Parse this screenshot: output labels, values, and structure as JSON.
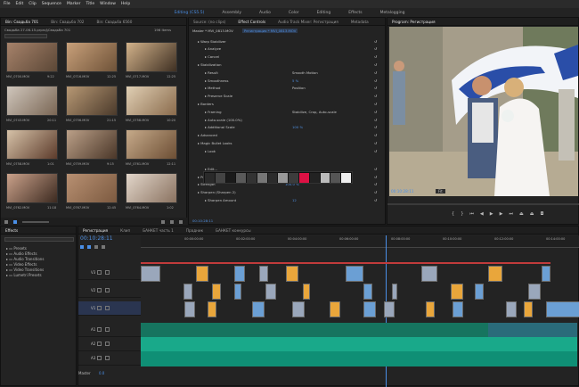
{
  "menu": [
    "File",
    "Edit",
    "Clip",
    "Sequence",
    "Marker",
    "Title",
    "Window",
    "Help"
  ],
  "workspaces": {
    "active": "Editing (CS5.5)",
    "items": [
      "Assembly",
      "Audio",
      "Color",
      "Editing",
      "Effects",
      "Metalogging"
    ]
  },
  "project": {
    "tabs": [
      "Bin: Свадьба 701",
      "Bin: Свадьба 702",
      "Bin: Свадьба 6560"
    ],
    "path": "Свадьба 27-06-15.prproj\\Свадьба 701",
    "count": "196 Items",
    "clips": [
      {
        "name": "MVI_0700.MOV",
        "dur": "9:22",
        "c1": "#a6826a",
        "c2": "#5b4736"
      },
      {
        "name": "MVI_0716.MOV",
        "dur": "12:25",
        "c1": "#c8a07a",
        "c2": "#6e5238"
      },
      {
        "name": "MVI_0717.MOV",
        "dur": "12:25",
        "c1": "#d2b28a",
        "c2": "#3e2f22"
      },
      {
        "name": "MVI_0743.MOV",
        "dur": "20:11",
        "c1": "#cfc6bc",
        "c2": "#7a6654"
      },
      {
        "name": "MVI_0756.MOV",
        "dur": "21:15",
        "c1": "#b79874",
        "c2": "#4b3a2b"
      },
      {
        "name": "MVI_0758.MOV",
        "dur": "10:20",
        "c1": "#e0cfb4",
        "c2": "#8a6b4c"
      },
      {
        "name": "MVI_0758.MOV",
        "dur": "1:01",
        "c1": "#d6c2a8",
        "c2": "#5c3b2b"
      },
      {
        "name": "MVI_0759.MOV",
        "dur": "9:15",
        "c1": "#bba088",
        "c2": "#4a3628"
      },
      {
        "name": "MVI_0761.MOV",
        "dur": "12:11",
        "c1": "#c6aa8a",
        "c2": "#6c4e34"
      },
      {
        "name": "MVI_0762.MOV",
        "dur": "11:18",
        "c1": "#caa18a",
        "c2": "#3c2a20"
      },
      {
        "name": "MVI_0767.MOV",
        "dur": "12:45",
        "c1": "#b89072",
        "c2": "#7c5a40"
      },
      {
        "name": "MVI_0764.MOV",
        "dur": "1:02",
        "c1": "#e2d6ca",
        "c2": "#8a7260"
      }
    ]
  },
  "source_tab": "Source: (no clips)",
  "effect_tab": "Effect Controls",
  "mixer_tab": "Audio Track Mixer: Регистрация",
  "metadata_tab": "Metadata",
  "effect_controls": {
    "header": "Master * MVI_0813.MOV",
    "header_seq": "Регистрация * MVI_0813.MOV",
    "rows": [
      {
        "indent": 0,
        "label": "Warp Stabilizer",
        "value": ""
      },
      {
        "indent": 1,
        "label": "Analyze",
        "value": ""
      },
      {
        "indent": 1,
        "label": "Cancel",
        "value": ""
      },
      {
        "indent": 0,
        "label": "Stabilization",
        "value": ""
      },
      {
        "indent": 1,
        "label": "Result",
        "value": "Smooth Motion"
      },
      {
        "indent": 1,
        "label": "Smoothness",
        "value": "5 %"
      },
      {
        "indent": 1,
        "label": "Method",
        "value": "Position"
      },
      {
        "indent": 1,
        "label": "Preserve Scale",
        "value": ""
      },
      {
        "indent": 0,
        "label": "Borders",
        "value": ""
      },
      {
        "indent": 1,
        "label": "Framing",
        "value": "Stabilize, Crop, Auto-scale"
      },
      {
        "indent": 1,
        "label": "Auto-scale (100.0%)",
        "value": ""
      },
      {
        "indent": 1,
        "label": "Additional Scale",
        "value": "100 %"
      },
      {
        "indent": 0,
        "label": "Advanced",
        "value": ""
      },
      {
        "indent": 0,
        "label": "Magic Bullet Looks",
        "value": ""
      },
      {
        "indent": 1,
        "label": "Look",
        "value": ""
      },
      {
        "indent": 1,
        "label": "Edit...",
        "value": ""
      },
      {
        "indent": 0,
        "label": "Power Mask",
        "value": ""
      },
      {
        "indent": 0,
        "label": "Strength",
        "value": "100.0 %"
      },
      {
        "indent": 0,
        "label": "Sharpen (Sharpen 2)",
        "value": ""
      },
      {
        "indent": 1,
        "label": "Sharpen Amount",
        "value": "12"
      }
    ],
    "timecode": "00:10:28:11"
  },
  "program": {
    "tab": "Program: Регистрация",
    "timecode": "00:10:28:11",
    "fit": "Fit"
  },
  "effects_panel": {
    "tab": "Effects",
    "items": [
      "Presets",
      "Audio Effects",
      "Audio Transitions",
      "Video Effects",
      "Video Transitions",
      "Lumetri Presets"
    ]
  },
  "timeline": {
    "tabs": [
      "Регистрация",
      "Клип",
      "БАНКЕТ часть 1",
      "Прадник",
      "БАНКЕТ конкурсы"
    ],
    "timecode": "00:10:28:11",
    "ruler": [
      "00:00:00:00",
      "00:02:00:00",
      "00:04:00:00",
      "00:06:00:00",
      "00:08:00:00",
      "00:10:00:00",
      "00:12:00:00",
      "00:14:00:00"
    ],
    "tracks": [
      "V3",
      "V2",
      "V1",
      "A1",
      "A2",
      "A3",
      "Master"
    ],
    "master_value": "0.0"
  },
  "colors": {
    "accent": "#4a8fe7",
    "audio": "#19a98a",
    "clip_orange": "#e9a63b",
    "clip_blue": "#6b9fd4"
  }
}
